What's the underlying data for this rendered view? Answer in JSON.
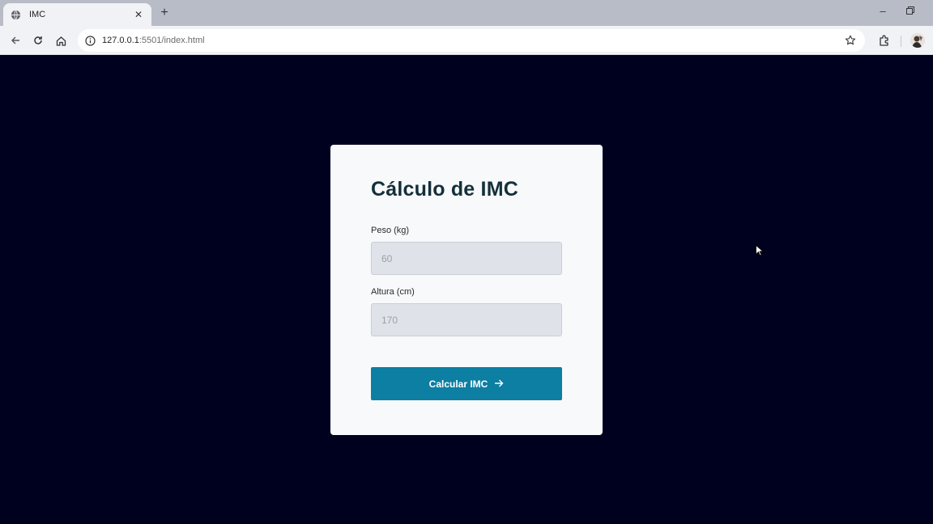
{
  "browser": {
    "tab_title": "IMC",
    "new_tab_label": "+",
    "url_host": "127.0.0.1",
    "url_rest": ":5501/index.html"
  },
  "card": {
    "title": "Cálculo de IMC",
    "weight": {
      "label": "Peso (kg)",
      "placeholder": "60",
      "value": ""
    },
    "height": {
      "label": "Altura (cm)",
      "placeholder": "170",
      "value": ""
    },
    "button_label": "Calcular IMC"
  },
  "colors": {
    "page_background": "#00001f",
    "card_background": "#f8f9fa",
    "title": "#13303b",
    "button": "#0c7fa3",
    "input_background": "#dfe3e9"
  },
  "icons": [
    "globe-icon",
    "close-icon",
    "back-icon",
    "reload-icon",
    "home-icon",
    "info-icon",
    "star-icon",
    "extensions-icon",
    "arrow-right-icon"
  ]
}
